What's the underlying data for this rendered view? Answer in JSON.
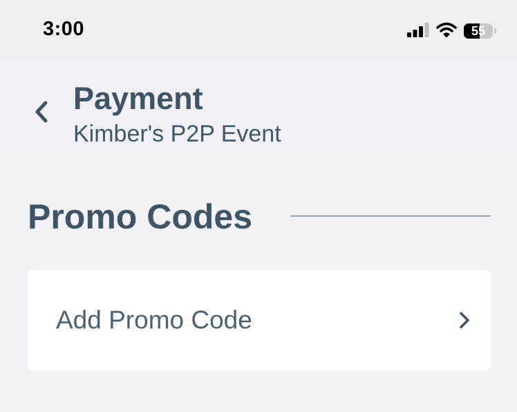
{
  "status_bar": {
    "time": "3:00",
    "battery_level": "55",
    "battery_percent": 55,
    "icons": [
      "cellular-signal-icon",
      "wifi-icon",
      "battery-icon"
    ]
  },
  "header": {
    "title": "Payment",
    "subtitle": "Kimber's P2P Event",
    "back_icon": "chevron-left-icon"
  },
  "promo_section": {
    "title": "Promo Codes",
    "add_label": "Add Promo Code",
    "row_icon": "chevron-right-icon"
  },
  "colors": {
    "background": "#f2f2f7",
    "card": "#ffffff",
    "primary_text": "#3d5566",
    "divider": "#9aa1a8"
  }
}
